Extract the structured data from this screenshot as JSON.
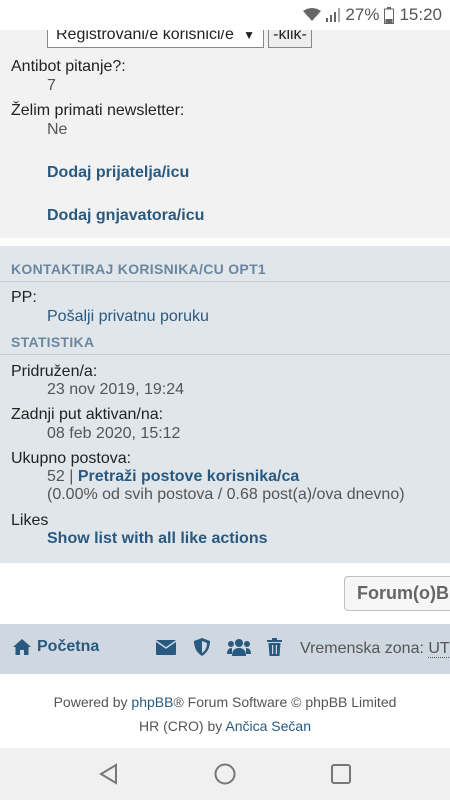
{
  "status_bar": {
    "battery": "27%",
    "time": "15:20"
  },
  "profile": {
    "select_value": "Registrovani/e korisnici/e",
    "klik_button": "-klik-",
    "antibot_label": "Antibot pitanje?:",
    "antibot_value": "7",
    "newsletter_label": "Želim primati newsletter:",
    "newsletter_value": "Ne",
    "add_friend": "Dodaj prijatelja/icu",
    "add_foe": "Dodaj gnjavatora/icu"
  },
  "contact": {
    "heading": "KONTAKTIRAJ KORISNIKA/CU OPT1",
    "pp_label": "PP:",
    "pp_link": "Pošalji privatnu poruku"
  },
  "stats": {
    "heading": "STATISTIKA",
    "joined_label": "Pridružen/a:",
    "joined_value": "23 nov 2019, 19:24",
    "last_active_label": "Zadnji put aktivan/na:",
    "last_active_value": "08 feb 2020, 15:12",
    "total_posts_label": "Ukupno postova:",
    "total_posts_count": "52 |",
    "search_posts_link": "Pretraži postove korisnika/ca",
    "posts_detail": "(0.00% od svih postova / 0.68 post(a)/ova dnevno)",
    "likes_label": "Likes",
    "likes_link": "Show list with all like actions"
  },
  "forum_button": "Forum(o)Bi",
  "navbar": {
    "home": "Početna",
    "timezone_label": "Vremenska zona:",
    "timezone_value": "UTC"
  },
  "footer": {
    "powered_by": "Powered by",
    "phpbb": "phpBB",
    "software": "® Forum Software © phpBB Limited",
    "translation": "HR (CRO) by",
    "translator": "Ančica Sečan"
  },
  "colors": {
    "link": "#2a5980",
    "panel_light": "#f2f2f2",
    "panel_blue": "#e1e6eb",
    "navbar": "#cfd8e0"
  }
}
